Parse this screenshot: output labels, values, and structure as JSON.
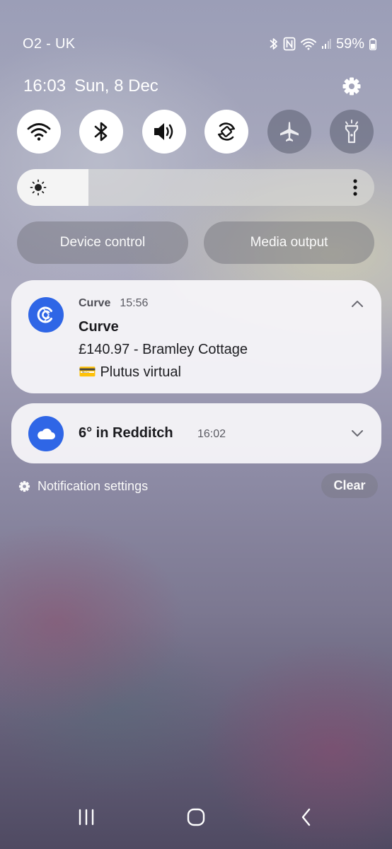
{
  "status_bar": {
    "carrier": "O2 - UK",
    "battery": "59%",
    "icons": [
      "bluetooth-icon",
      "nfc-icon",
      "wifi-icon",
      "signal-icon",
      "battery-icon"
    ]
  },
  "header": {
    "time": "16:03",
    "date": "Sun, 8 Dec"
  },
  "quick_settings": {
    "toggles": [
      {
        "name": "wifi",
        "icon": "wifi-icon",
        "on": true
      },
      {
        "name": "bluetooth",
        "icon": "bluetooth-icon",
        "on": true
      },
      {
        "name": "sound",
        "icon": "volume-icon",
        "on": true
      },
      {
        "name": "auto-rotate",
        "icon": "rotate-icon",
        "on": true
      },
      {
        "name": "airplane-mode",
        "icon": "airplane-icon",
        "on": false
      },
      {
        "name": "flashlight",
        "icon": "flashlight-icon",
        "on": false
      }
    ],
    "brightness_level": 0.2,
    "device_control_label": "Device control",
    "media_output_label": "Media output"
  },
  "notifications": [
    {
      "app": "Curve",
      "time": "15:56",
      "title": "Curve",
      "line1": "£140.97 - Bramley Cottage",
      "line2": "💳 Plutus virtual",
      "expanded": true,
      "accent": "#2f66e6"
    },
    {
      "title": "6° in Redditch",
      "time": "16:02",
      "expanded": false,
      "accent": "#2f66e6"
    }
  ],
  "footer": {
    "notification_settings_label": "Notification settings",
    "clear_label": "Clear"
  },
  "colors": {
    "toggle_on": "#ffffff",
    "toggle_off": "#5a5c70",
    "app_accent": "#2f66e6"
  }
}
